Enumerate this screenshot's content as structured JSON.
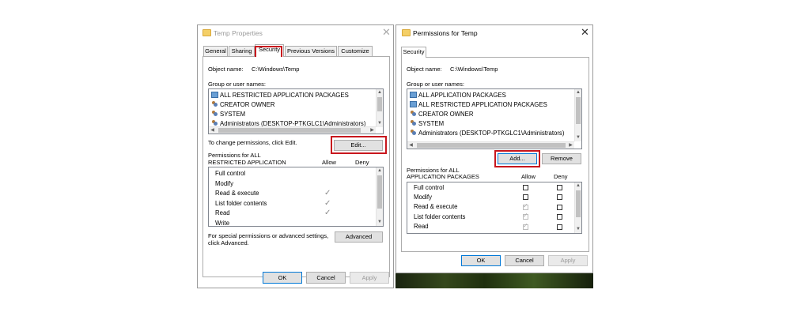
{
  "left": {
    "title": "Temp Properties",
    "tabs": [
      "General",
      "Sharing",
      "Security",
      "Previous Versions",
      "Customize"
    ],
    "object_label": "Object name:",
    "object_value": "C:\\Windows\\Temp",
    "group_label": "Group or user names:",
    "users": [
      {
        "name": "ALL RESTRICTED APPLICATION PACKAGES",
        "icon": "group-icon"
      },
      {
        "name": "CREATOR OWNER",
        "icon": "user-icon"
      },
      {
        "name": "SYSTEM",
        "icon": "user-icon"
      },
      {
        "name": "Administrators (DESKTOP-PTKGLC1\\Administrators)",
        "icon": "user-icon"
      }
    ],
    "change_text": "To change permissions, click Edit.",
    "edit_label": "Edit...",
    "perm_for_line1": "Permissions for ALL",
    "perm_for_line2": "RESTRICTED APPLICATION",
    "allow": "Allow",
    "deny": "Deny",
    "perms": [
      "Full control",
      "Modify",
      "Read & execute",
      "List folder contents",
      "Read",
      "Write"
    ],
    "allow_checks": [
      false,
      false,
      true,
      true,
      true,
      false
    ],
    "special_line1": "For special permissions or advanced settings,",
    "special_line2": "click Advanced.",
    "advanced_label": "Advanced",
    "ok": "OK",
    "cancel": "Cancel",
    "apply": "Apply"
  },
  "right": {
    "title": "Permissions for Temp",
    "tab": "Security",
    "object_label": "Object name:",
    "object_value": "C:\\Windows\\Temp",
    "group_label": "Group or user names:",
    "users": [
      {
        "name": "ALL APPLICATION PACKAGES",
        "icon": "group-icon"
      },
      {
        "name": "ALL RESTRICTED APPLICATION PACKAGES",
        "icon": "group-icon"
      },
      {
        "name": "CREATOR OWNER",
        "icon": "user-icon"
      },
      {
        "name": "SYSTEM",
        "icon": "user-icon"
      },
      {
        "name": "Administrators (DESKTOP-PTKGLC1\\Administrators)",
        "icon": "user-icon"
      }
    ],
    "add_label": "Add...",
    "remove_label": "Remove",
    "perm_for_line1": "Permissions for ALL",
    "perm_for_line2": "APPLICATION PACKAGES",
    "allow": "Allow",
    "deny": "Deny",
    "perms": [
      "Full control",
      "Modify",
      "Read & execute",
      "List folder contents",
      "Read"
    ],
    "allow_state": [
      "empty",
      "empty",
      "dimchecked",
      "dimchecked",
      "dimchecked"
    ],
    "deny_state": [
      "empty",
      "empty",
      "empty",
      "empty",
      "empty"
    ],
    "ok": "OK",
    "cancel": "Cancel",
    "apply": "Apply"
  },
  "colors": {
    "highlight": "#c8161d",
    "focus": "#0078d7"
  }
}
